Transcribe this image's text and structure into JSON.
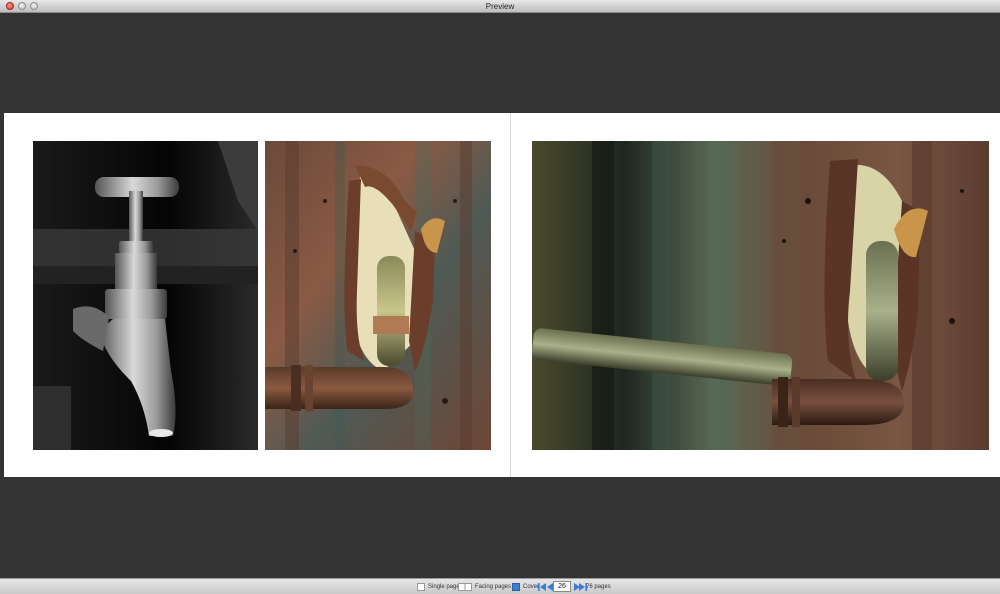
{
  "window": {
    "title": "Preview"
  },
  "photos": [
    {
      "subject": "faucet-bw",
      "tone": "black-and-white"
    },
    {
      "subject": "rusty-pipe-closeup",
      "tone": "color"
    },
    {
      "subject": "rusty-pipe-wide",
      "tone": "color"
    }
  ],
  "toolbar": {
    "single_pages_label": "Single pages",
    "facing_pages_label": "Facing pages",
    "cover_label": "Cover",
    "current_page": "26",
    "page_count_label": "76 pages"
  },
  "icons": {
    "first": "first-page-icon",
    "prev": "previous-page-icon",
    "next": "next-page-icon",
    "last": "last-page-icon"
  },
  "colors": {
    "background": "#333333",
    "nav_blue": "#3a7bd5",
    "close_red": "#d8372a"
  }
}
